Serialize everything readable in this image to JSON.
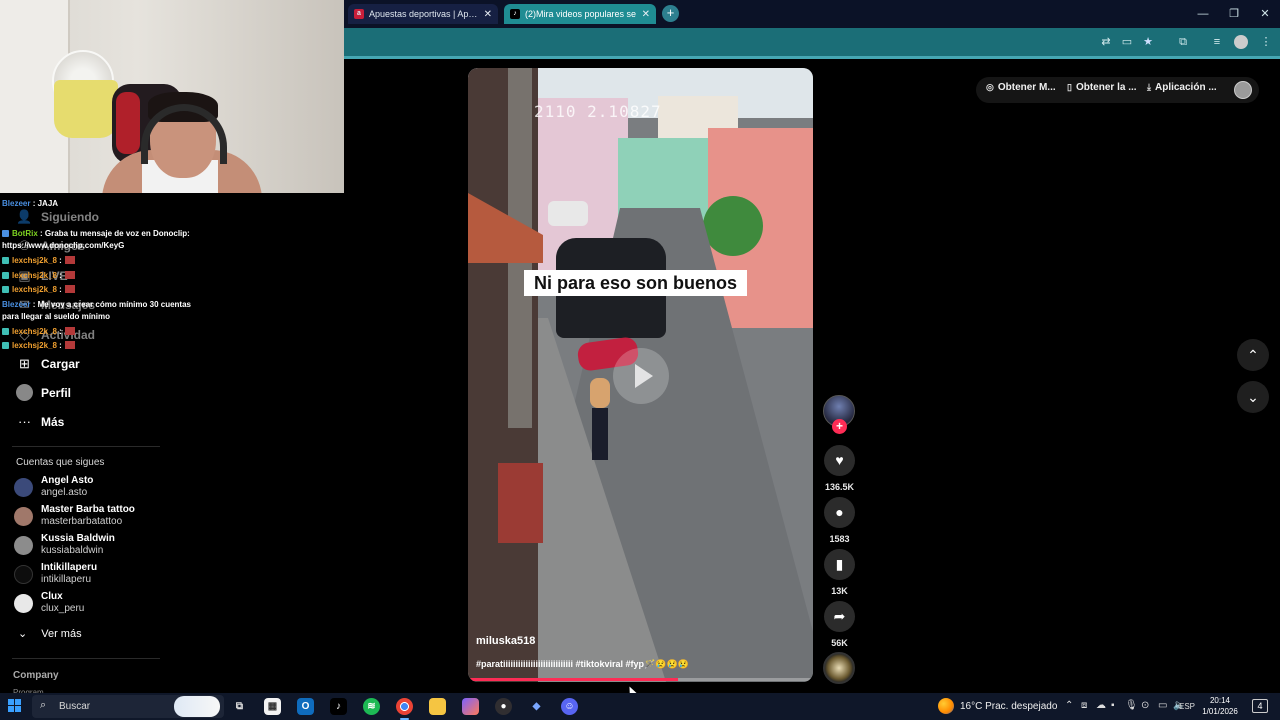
{
  "browser": {
    "tabs": [
      {
        "title": "Apuestas deportivas | Apuesta",
        "favicon": "a",
        "favicon_color": "#c81e3a"
      },
      {
        "title": "(2)Mira videos populares se",
        "favicon": "♪",
        "favicon_color": "#000000"
      }
    ],
    "accent_color": "#1b6e77"
  },
  "chat": [
    {
      "user": "Blezeer",
      "message": ": JAJA",
      "color": "blue"
    },
    {
      "user": "BotRix",
      "message": ": Graba tu mensaje de voz en Donoclip:",
      "color": "green"
    },
    {
      "user": "",
      "message": "https://www.donoclip.com/KeyG",
      "color": "white"
    },
    {
      "user": "lexchsj2k_8",
      "message": ":",
      "color": "orange"
    },
    {
      "user": "lexchsj2k_8",
      "message": ":",
      "color": "orange"
    },
    {
      "user": "lexchsj2k_8",
      "message": ":",
      "color": "orange"
    },
    {
      "user": "Blezeer",
      "message": ": Me voy a crear cómo mínimo 30 cuentas",
      "color": "blue"
    },
    {
      "user": "",
      "message": "para llegar al sueldo mínimo",
      "color": "white"
    },
    {
      "user": "lexchsj2k_8",
      "message": ":",
      "color": "orange"
    },
    {
      "user": "lexchsj2k_8",
      "message": ":",
      "color": "orange"
    }
  ],
  "sidebar": {
    "nav": [
      {
        "label": "Siguiendo",
        "icon": "following-icon"
      },
      {
        "label": "Amigos",
        "icon": "friends-icon"
      },
      {
        "label": "LIVE",
        "icon": "live-icon"
      },
      {
        "label": "Mensajes",
        "icon": "messages-icon"
      },
      {
        "label": "Actividad",
        "icon": "activity-icon"
      },
      {
        "label": "Cargar",
        "icon": "upload-icon"
      },
      {
        "label": "Perfil",
        "icon": "profile-icon"
      },
      {
        "label": "Más",
        "icon": "more-icon"
      }
    ],
    "following_title": "Cuentas que sigues",
    "accounts": [
      {
        "name": "Angel Asto",
        "handle": "angel.asto"
      },
      {
        "name": "Master Barba tattoo",
        "handle": "masterbarbatattoo"
      },
      {
        "name": "Kussia Baldwin",
        "handle": "kussiabaldwin"
      },
      {
        "name": "Intikillaperu",
        "handle": "intikillaperu"
      },
      {
        "name": "Clux",
        "handle": "clux_peru"
      }
    ],
    "see_more": "Ver más",
    "footer_title": "Company",
    "footer_sub": "Program"
  },
  "video": {
    "timestamp": "2110 2.10827",
    "caption": "Ni para eso son buenos",
    "author": "miluska518",
    "hashtags": "#paratiiiiiiiiiiiiiiiiiiiiiiiiiiii #tiktokviral #fyp🪄😢😢😢",
    "progress": 0.61
  },
  "actions": {
    "likes": "136.5K",
    "comments": "1583",
    "saves": "13K",
    "shares": "56K"
  },
  "top_pills": [
    {
      "label": "Obtener M...",
      "icon": "coin-icon"
    },
    {
      "label": "Obtener la ...",
      "icon": "phone-icon"
    },
    {
      "label": "Aplicación ...",
      "icon": "download-icon"
    }
  ],
  "taskbar": {
    "search_placeholder": "Buscar",
    "weather": "16°C  Prac. despejado",
    "language": "ESP",
    "time": "20:14",
    "date": "1/01/2026",
    "notifications": "4"
  }
}
